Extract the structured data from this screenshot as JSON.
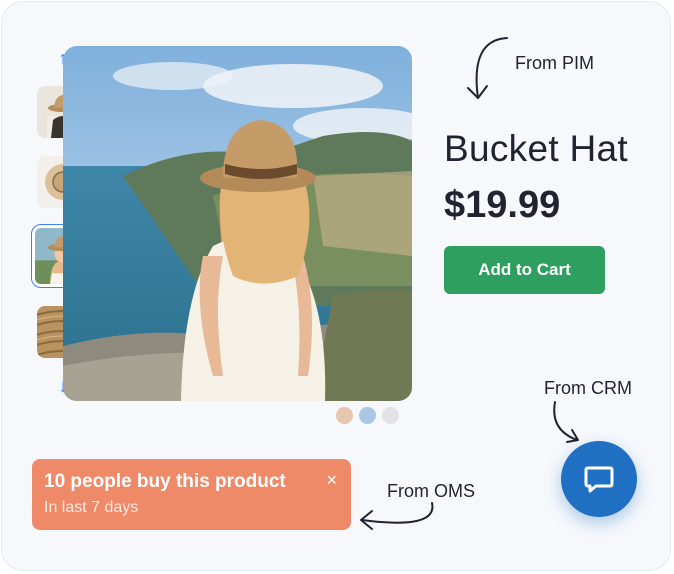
{
  "product": {
    "title": "Bucket Hat",
    "price": "$19.99",
    "add_to_cart_label": "Add to Cart"
  },
  "gallery": {
    "up_arrow": "↑",
    "down_arrow": "↓",
    "thumbnails": [
      {
        "icon": "hat-on-person-back"
      },
      {
        "icon": "hat-top-view"
      },
      {
        "icon": "woman-wearing-hat",
        "selected": true
      },
      {
        "icon": "straw-texture-closeup"
      }
    ],
    "dot_colors": [
      "#e7c6b0",
      "#a9c8e6",
      "#e3e3e7"
    ]
  },
  "annotations": {
    "pim": "From PIM",
    "crm": "From CRM",
    "oms": "From OMS"
  },
  "oms_banner": {
    "title": "10 people buy this product",
    "subtitle": "In last 7 days",
    "close_glyph": "×"
  },
  "chat": {
    "icon": "chat-bubble-icon"
  },
  "colors": {
    "accent_blue": "#3b82f6",
    "cart_green": "#2f9f5f",
    "banner_orange": "#ef8a69",
    "chat_blue": "#1f6fc2"
  }
}
